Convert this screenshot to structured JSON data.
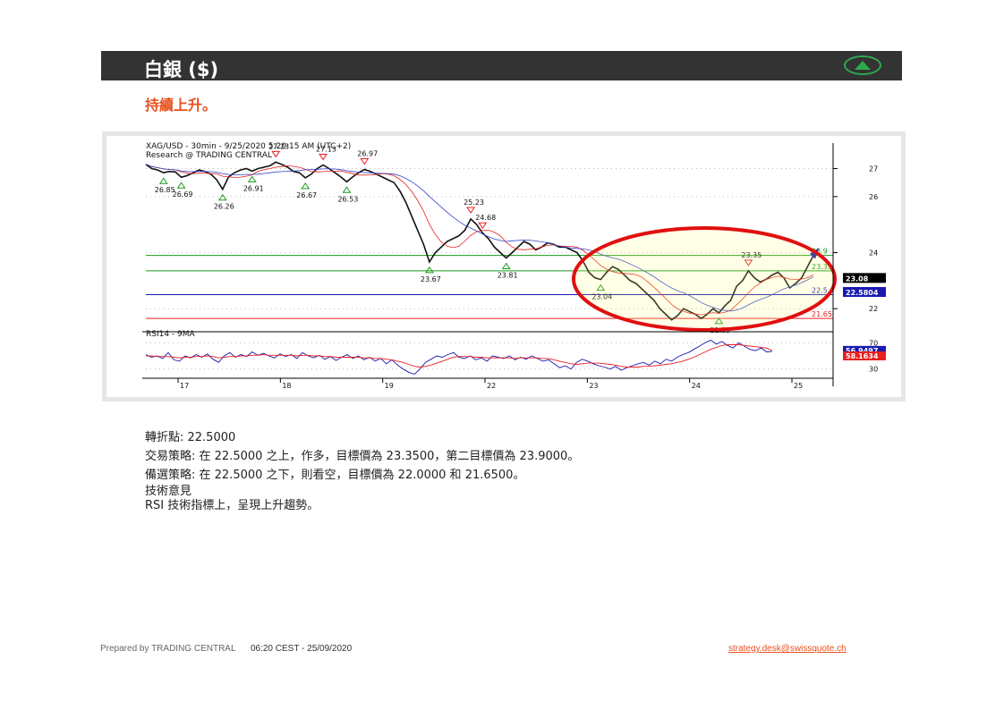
{
  "header": {
    "title": "白銀 ($)",
    "trend_icon": "up-triangle-icon",
    "accent_color": "#2fa84f"
  },
  "subtitle": "持續上升。",
  "chart_data": {
    "type": "line",
    "title": "XAG/USD - 30min - 9/25/2020 5:20:15 AM (UTC+2)",
    "source": "Research @ TRADING CENTRAL",
    "x_ticks": [
      "17",
      "18",
      "19",
      "22",
      "23",
      "24",
      "25"
    ],
    "y_ticks": [
      27,
      26,
      24,
      22
    ],
    "ylim": [
      21.4,
      27.4
    ],
    "price": [
      27.15,
      27.0,
      26.95,
      26.85,
      26.9,
      26.88,
      26.69,
      26.75,
      26.85,
      26.95,
      26.9,
      26.8,
      26.6,
      26.26,
      26.7,
      26.85,
      26.95,
      27.0,
      26.91,
      27.0,
      27.05,
      27.1,
      27.23,
      27.15,
      27.05,
      26.9,
      26.85,
      26.67,
      26.8,
      27.0,
      27.13,
      27.0,
      26.85,
      26.7,
      26.53,
      26.7,
      26.85,
      26.97,
      26.9,
      26.8,
      26.7,
      26.6,
      26.5,
      26.2,
      25.8,
      25.3,
      24.8,
      24.3,
      23.67,
      24.0,
      24.2,
      24.4,
      24.5,
      24.6,
      24.8,
      25.2,
      25.0,
      24.7,
      24.5,
      24.2,
      24.0,
      23.81,
      24.0,
      24.2,
      24.4,
      24.3,
      24.1,
      24.2,
      24.35,
      24.3,
      24.2,
      24.2,
      24.1,
      24.0,
      23.7,
      23.3,
      23.1,
      23.04,
      23.3,
      23.5,
      23.4,
      23.2,
      23.0,
      22.9,
      22.7,
      22.5,
      22.3,
      22.0,
      21.8,
      21.6,
      21.75,
      22.0,
      21.9,
      21.8,
      21.65,
      21.8,
      22.0,
      21.85,
      22.1,
      22.3,
      22.8,
      23.0,
      23.35,
      23.1,
      22.95,
      23.05,
      23.2,
      23.3,
      23.1,
      22.74,
      22.9,
      23.1,
      23.5,
      23.9
    ],
    "pivot_labels": {
      "lows": [
        26.85,
        26.69,
        26.26,
        26.91,
        26.67,
        26.53,
        23.67,
        23.81,
        23.04,
        21.85
      ],
      "highs": [
        27.23,
        27.13,
        26.97,
        25.23,
        24.68,
        23.35
      ]
    },
    "levels": [
      {
        "value": 23.9,
        "label": "23.9",
        "color": "#1a9a1a"
      },
      {
        "value": 23.35,
        "label": "23.35",
        "color": "#1a9a1a"
      },
      {
        "value": 22.5,
        "label": "22.5",
        "color": "#1a1ab0"
      },
      {
        "value": 21.65,
        "label": "21.65",
        "color": "#e82020"
      }
    ],
    "markers": [
      {
        "value": 23.08,
        "label": "23.08",
        "bg": "#000000",
        "fg": "#ffffff"
      },
      {
        "value": 22.5804,
        "label": "22.5804",
        "bg": "#1a1ab0",
        "fg": "#ffffff"
      }
    ],
    "rsi": {
      "label": "RSI14 - 9MA",
      "ylim": [
        20,
        80
      ],
      "y_ticks": [
        70,
        30
      ],
      "last_rsi": "56.9497",
      "last_ma": "58.1634",
      "rsi_color": "#1a1ab0",
      "ma_color": "#e82020",
      "rsi": [
        52,
        48,
        50,
        46,
        55,
        44,
        42,
        50,
        47,
        52,
        48,
        53,
        45,
        40,
        50,
        55,
        48,
        52,
        49,
        56,
        51,
        54,
        50,
        47,
        53,
        49,
        52,
        46,
        55,
        50,
        47,
        51,
        45,
        49,
        43,
        48,
        52,
        46,
        50,
        44,
        48,
        42,
        46,
        38,
        44,
        36,
        30,
        25,
        22,
        30,
        40,
        45,
        50,
        48,
        52,
        55,
        48,
        46,
        50,
        44,
        47,
        42,
        50,
        48,
        46,
        50,
        44,
        48,
        45,
        50,
        46,
        42,
        44,
        38,
        32,
        35,
        30,
        40,
        45,
        42,
        38,
        35,
        33,
        30,
        34,
        28,
        32,
        35,
        38,
        40,
        36,
        42,
        38,
        45,
        42,
        48,
        52,
        55,
        60,
        65,
        70,
        74,
        68,
        72,
        66,
        62,
        70,
        65,
        60,
        58,
        62,
        56,
        57
      ],
      "ma": [
        50,
        50,
        49,
        49,
        49,
        48,
        47,
        48,
        48,
        49,
        49,
        50,
        49,
        47,
        48,
        49,
        49,
        50,
        50,
        51,
        51,
        52,
        51,
        51,
        51,
        51,
        51,
        50,
        51,
        51,
        50,
        50,
        49,
        49,
        48,
        48,
        48,
        48,
        48,
        47,
        47,
        46,
        46,
        45,
        44,
        42,
        40,
        37,
        34,
        33,
        34,
        36,
        39,
        42,
        45,
        48,
        49,
        49,
        49,
        48,
        48,
        47,
        47,
        47,
        47,
        47,
        46,
        47,
        47,
        47,
        47,
        46,
        46,
        44,
        42,
        40,
        38,
        37,
        38,
        39,
        39,
        39,
        38,
        37,
        36,
        34,
        33,
        33,
        33,
        34,
        34,
        35,
        36,
        37,
        38,
        40,
        42,
        45,
        48,
        52,
        56,
        60,
        63,
        66,
        67,
        67,
        67,
        66,
        65,
        64,
        63,
        62,
        58
      ]
    }
  },
  "notes": {
    "pivot": "轉折點: 22.5000",
    "strategy": "交易策略: 在 22.5000 之上，作多，目標價為  23.3500，第二目標價為  23.9000。",
    "alternative": "備選策略: 在 22.5000 之下，則看空，目標價為  22.0000 和 21.6500。",
    "comment_heading": "技術意見",
    "comment": "RSI 技術指標上，呈現上升趨勢。"
  },
  "footer": {
    "prepared_by": "Prepared by TRADING CENTRAL",
    "timestamp": "06:20 CEST  - 25/09/2020",
    "email": "strategy.desk@swissquote.ch"
  }
}
